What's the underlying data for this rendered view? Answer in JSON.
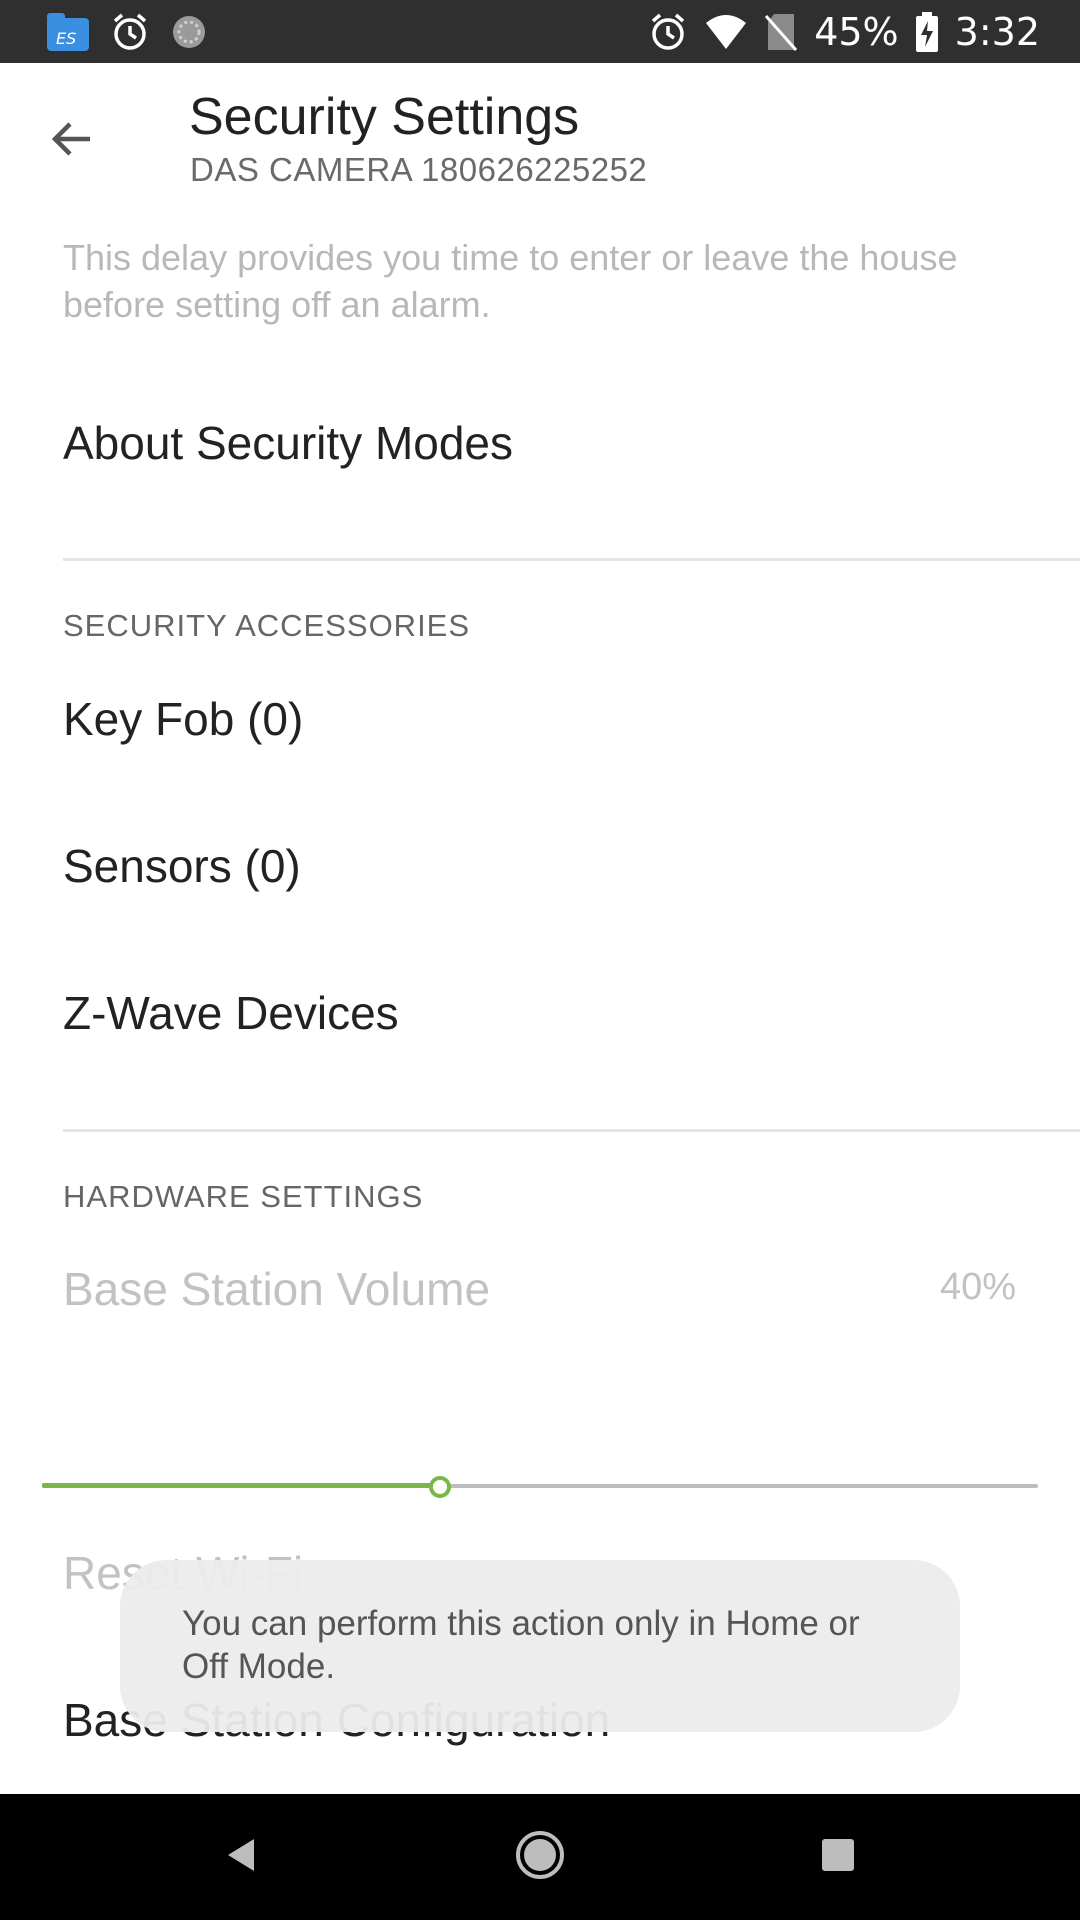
{
  "status_bar": {
    "left_icons": [
      "file-manager-icon",
      "alarm-clock-icon",
      "sync-icon"
    ],
    "battery_percent": "45%",
    "time": "3:32",
    "right_icons": [
      "alarm-clock-icon",
      "wifi-icon",
      "no-sim-icon",
      "battery-charging-icon"
    ]
  },
  "header": {
    "back_icon": "arrow-left-icon",
    "title": "Security Settings",
    "subtitle": "DAS CAMERA 180626225252"
  },
  "description": "This delay provides you time to enter or leave the house before setting off an alarm.",
  "about_security_modes": "About Security Modes",
  "sections": {
    "security_accessories": {
      "label": "SECURITY ACCESSORIES",
      "items": [
        {
          "label": "Key Fob (0)"
        },
        {
          "label": "Sensors (0)"
        },
        {
          "label": "Z-Wave Devices"
        }
      ]
    },
    "hardware_settings": {
      "label": "HARDWARE SETTINGS",
      "base_station_volume": {
        "label": "Base Station Volume",
        "value": "40%",
        "level": 0.4
      },
      "reset_wifi": "Reset Wi-Fi",
      "base_station_configuration": "Base Station Configuration"
    }
  },
  "toast": "You can perform this action only in Home or Off Mode.",
  "nav_bar": {
    "icons": [
      "back-triangle-icon",
      "home-circle-icon",
      "recents-square-icon"
    ]
  },
  "colors": {
    "accent": "#7ab648",
    "status_bar": "#2f2f2f",
    "nav_bar": "#000000"
  }
}
